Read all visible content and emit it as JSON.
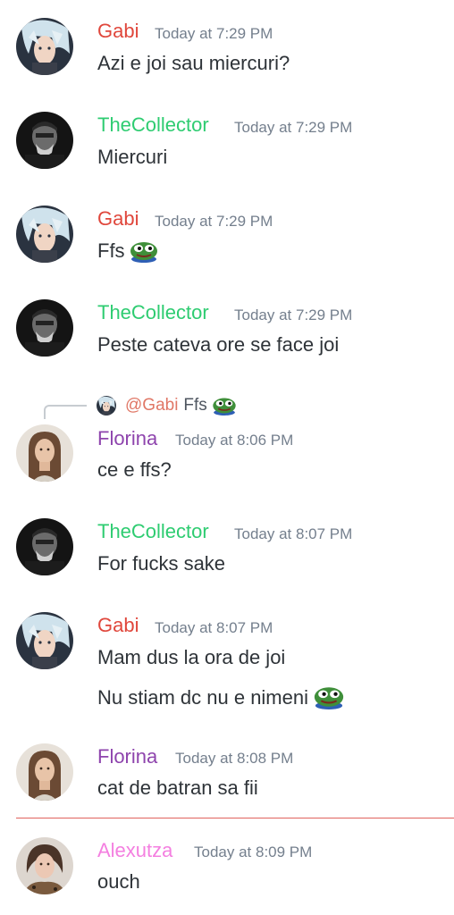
{
  "colors": {
    "gabi": "#e0473c",
    "collector": "#2ecc71",
    "florina": "#8e44ad",
    "alexutza": "#f47fe0",
    "timestamp": "#747f8d",
    "text": "#2e3338",
    "new_divider": "#e0625d"
  },
  "messages": [
    {
      "author": "Gabi",
      "time": "Today at 7:29 PM",
      "lines": [
        "Azi e joi sau miercuri?"
      ]
    },
    {
      "author": "TheCollector",
      "time": "Today at 7:29 PM",
      "lines": [
        "Miercuri"
      ]
    },
    {
      "author": "Gabi",
      "time": "Today at 7:29 PM",
      "lines": [
        "Ffs"
      ],
      "emoji": "peepo-emoji"
    },
    {
      "author": "TheCollector",
      "time": "Today at 7:29 PM",
      "lines": [
        "Peste cateva ore se face joi"
      ]
    },
    {
      "reply": {
        "mention": "@Gabi",
        "text": "Ffs",
        "emoji": "peepo-emoji"
      },
      "author": "Florina",
      "time": "Today at 8:06 PM",
      "lines": [
        "ce e ffs?"
      ]
    },
    {
      "author": "TheCollector",
      "time": "Today at 8:07 PM",
      "lines": [
        "For fucks sake"
      ]
    },
    {
      "author": "Gabi",
      "time": "Today at 8:07 PM",
      "lines": [
        "Mam dus la ora de joi",
        "Nu stiam dc nu e nimeni"
      ],
      "emoji": "peepo-sad-emoji"
    },
    {
      "author": "Florina",
      "time": "Today at 8:08 PM",
      "lines": [
        "cat de batran sa fii"
      ]
    },
    {
      "author": "Alexutza",
      "time": "Today at 8:09 PM",
      "lines": [
        "ouch"
      ]
    }
  ]
}
